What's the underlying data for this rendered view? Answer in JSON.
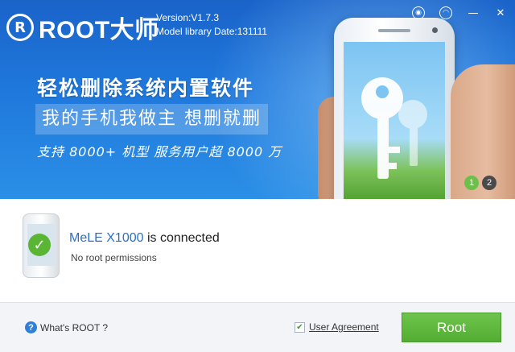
{
  "app": {
    "logo_badge": "R",
    "logo_text": "ROOT大师",
    "version": "Version:V1.7.3",
    "model_library": "Model library Date:131111"
  },
  "window_controls": [
    {
      "icon": "eye-icon",
      "glyph": "◉"
    },
    {
      "icon": "chat-icon",
      "glyph": "◠"
    },
    {
      "icon": "minimize-icon",
      "glyph": "—"
    },
    {
      "icon": "close-icon",
      "glyph": "✕"
    }
  ],
  "banner": {
    "headline": "轻松删除系统内置软件",
    "subline": "我的手机我做主 想删就删",
    "tagline": "支持 8000+ 机型  服务用户超 8000 万",
    "slides": [
      "1",
      "2"
    ],
    "active_slide": "1"
  },
  "device": {
    "model": "MeLE X1000",
    "status_suffix": " is connected",
    "permission": "No root permissions"
  },
  "footer": {
    "help_label": "What's ROOT ?",
    "agreement_label": "User Agreement",
    "agreement_checked": true,
    "root_button": "Root"
  },
  "colors": {
    "banner_blue": "#1f78dc",
    "accent_green": "#5ab534",
    "link_blue": "#2b6fc4"
  }
}
